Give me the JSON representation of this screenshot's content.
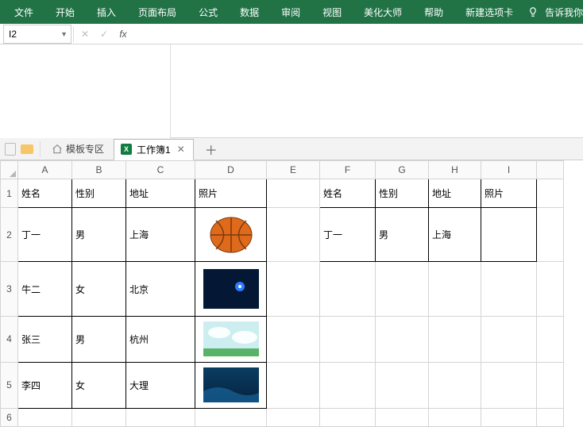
{
  "ribbon": {
    "tabs": [
      "文件",
      "开始",
      "插入",
      "页面布局",
      "公式",
      "数据",
      "审阅",
      "视图",
      "美化大师",
      "帮助",
      "新建选项卡"
    ],
    "tell_me": "告诉我你"
  },
  "namebox": "I2",
  "tabsrow": {
    "template": "模板专区",
    "workbook": "工作簿1"
  },
  "colheaders": [
    "A",
    "B",
    "C",
    "D",
    "E",
    "F",
    "G",
    "H",
    "I"
  ],
  "rowheaders": [
    "1",
    "2",
    "3",
    "4",
    "5",
    "6"
  ],
  "left": {
    "hdr": {
      "name": "姓名",
      "sex": "性别",
      "addr": "地址",
      "photo": "照片"
    },
    "rows": [
      {
        "name": "丁一",
        "sex": "男",
        "addr": "上海",
        "photo": "basketball"
      },
      {
        "name": "牛二",
        "sex": "女",
        "addr": "北京",
        "photo": "space"
      },
      {
        "name": "张三",
        "sex": "男",
        "addr": "杭州",
        "photo": "sky"
      },
      {
        "name": "李四",
        "sex": "女",
        "addr": "大理",
        "photo": "ocean"
      }
    ]
  },
  "right": {
    "hdr": {
      "name": "姓名",
      "sex": "性别",
      "addr": "地址",
      "photo": "照片"
    },
    "rows": [
      {
        "name": "丁一",
        "sex": "男",
        "addr": "上海",
        "photo": ""
      }
    ]
  }
}
